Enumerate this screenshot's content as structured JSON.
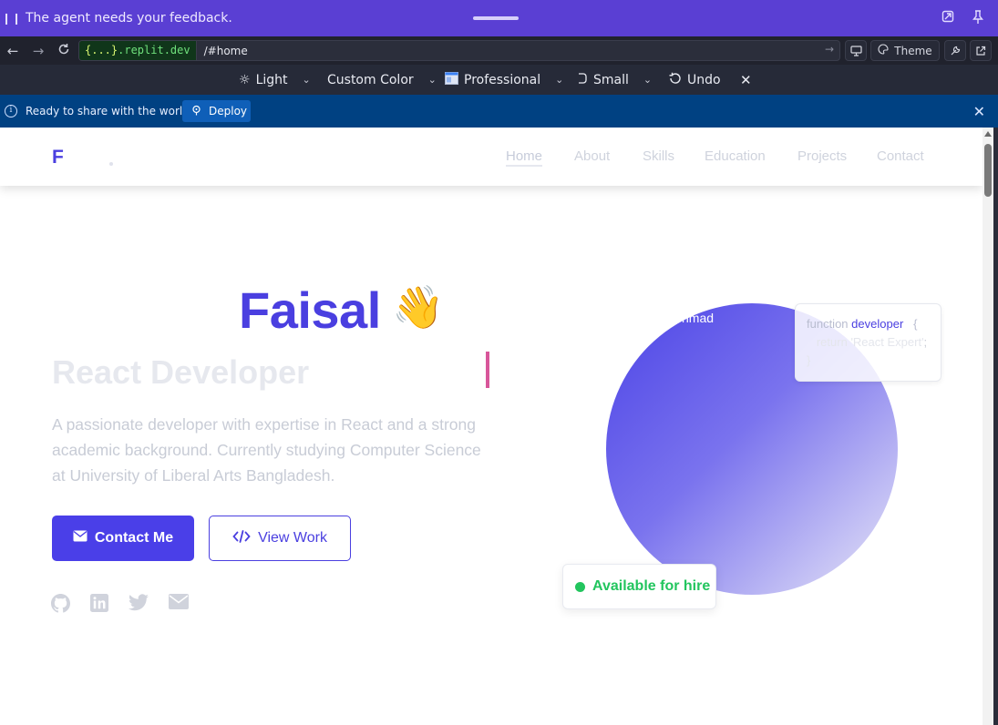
{
  "agent_bar": {
    "message": "The agent needs your feedback."
  },
  "url_bar": {
    "domain_prefix": "{...}",
    "domain_suffix": ".replit.dev",
    "path": "/#home",
    "theme_label": "Theme"
  },
  "theme_toolbar": {
    "mode": "Light",
    "color": "Custom Color",
    "style": "Professional",
    "size": "Small",
    "undo": "Undo"
  },
  "deploy_bar": {
    "message": "Ready to share with the world?",
    "deploy_label": "Deploy"
  },
  "site": {
    "logo": "F",
    "nav": [
      "Home",
      "About",
      "Skills",
      "Education",
      "Projects",
      "Contact"
    ],
    "active_nav": "Home",
    "hero": {
      "name": "Faisal",
      "wave": "👋",
      "role": "React Developer",
      "bio": "A passionate developer with expertise in React and a strong academic background. Currently studying Computer Science at University of Liberal Arts Bangladesh.",
      "primary_button": "Contact Me",
      "secondary_button": "View Work",
      "social_icons": [
        "github-icon",
        "linkedin-icon",
        "twitter-icon",
        "mail-icon"
      ],
      "photo_caption": "nmad",
      "code_card": {
        "keyword": "function",
        "fn_name": "developer",
        "open_brace": "{",
        "line2_key": "return",
        "line2_value": "'React Expert'",
        "line2_end": ";",
        "close_brace": "}"
      },
      "availability": "Available for hire"
    }
  },
  "colors": {
    "brand": "#4a3fe0",
    "agent_bar": "#5a3fd3",
    "deploy_bar": "#004182",
    "available": "#22c55e"
  }
}
